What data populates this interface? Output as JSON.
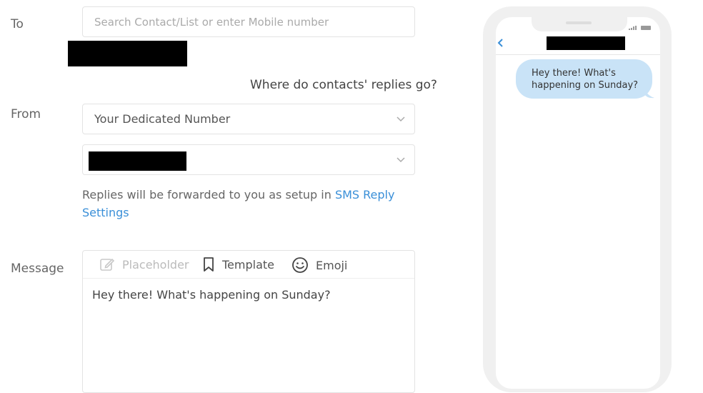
{
  "form": {
    "to": {
      "label": "To",
      "search_placeholder": "Search Contact/List or enter Mobile number"
    },
    "replies_link": "Where do contacts' replies go?",
    "from": {
      "label": "From",
      "number_type": "Your Dedicated Number"
    },
    "forward_note": {
      "prefix": "Replies will be forwarded to you as setup in",
      "link_part1": "SMS Reply",
      "link_part2": "Settings"
    },
    "message": {
      "label": "Message",
      "toolbar": {
        "placeholder": "Placeholder",
        "template": "Template",
        "emoji": "Emoji"
      },
      "body": "Hey there! What's happening on Sunday?"
    }
  },
  "phone_preview": {
    "bubble_text": "Hey there! What's happening on Sunday?"
  },
  "colors": {
    "link": "#3a8fd8",
    "bubble": "#c9e3f7",
    "phone_frame": "#f0f0f0"
  }
}
